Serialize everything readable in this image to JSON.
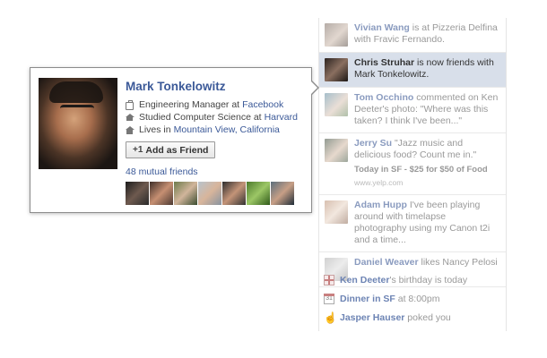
{
  "hovercard": {
    "name": "Mark Tonkelowitz",
    "work_prefix": "Engineering Manager at",
    "work_link": "Facebook",
    "school_prefix": "Studied Computer Science at",
    "school_link": "Harvard",
    "home_prefix": "Lives in",
    "home_link": "Mountain View, California",
    "add_friend_label": "Add as Friend",
    "mutual_friends": "48 mutual friends"
  },
  "ticker": [
    {
      "name": "Vivian Wang",
      "text": " is at Pizzeria Delfina with Fravic Fernando."
    },
    {
      "name": "Chris Struhar",
      "text": " is now friends with Mark Tonkelowitz."
    },
    {
      "name": "Tom Occhino",
      "text": " commented on Ken Deeter's photo: \"Where was this taken? I think I've been...\""
    },
    {
      "name": "Jerry Su",
      "text": " \"Jazz music and delicious food? Count me in.\"",
      "sub": "Today in SF - $25 for $50 of Food",
      "url": "www.yelp.com"
    },
    {
      "name": "Adam Hupp",
      "text": " I've been playing around with timelapse photography using my Canon t2i and a time..."
    },
    {
      "name": "Daniel Weaver",
      "text": " likes Nancy Pelosi"
    }
  ],
  "notifications": [
    {
      "icon": "gift-icon",
      "name": "Ken Deeter",
      "text": "'s birthday is today"
    },
    {
      "icon": "calendar-icon",
      "name": "Dinner in SF",
      "text": " at 8:00pm",
      "cal_day": "31"
    },
    {
      "icon": "poke-icon",
      "name": "Jasper Hauser",
      "text": " poked you"
    }
  ]
}
